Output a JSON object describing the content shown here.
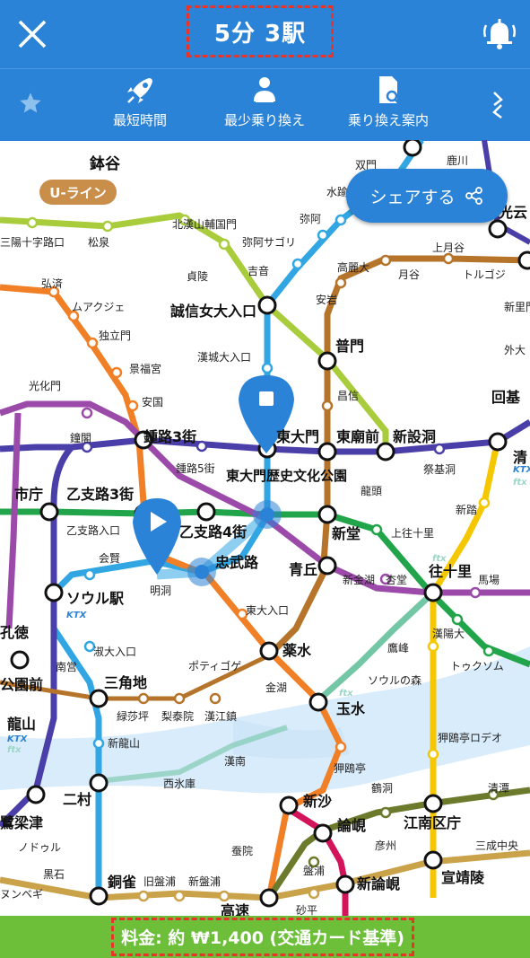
{
  "header": {
    "title": "5分 3駅"
  },
  "toolbar": {
    "items": [
      {
        "label": "最短時間",
        "icon": "rocket-icon"
      },
      {
        "label": "最少乗り換え",
        "icon": "person-icon"
      },
      {
        "label": "乗り換え案内",
        "icon": "document-search-icon"
      }
    ]
  },
  "share": {
    "label": "シェアする"
  },
  "fare": {
    "text": "料金: 約 ₩1,400 (交通カード基準)"
  },
  "map": {
    "badge": "U-ライン",
    "stations_bold": [
      "鉢谷",
      "誠信女大入口",
      "普門",
      "東廟前",
      "新設洞",
      "鍾路3街",
      "東大門",
      "回基",
      "市庁",
      "乙支路3街",
      "乙支路4街",
      "東大門歴史文化公園",
      "忠武路",
      "新堂",
      "往十里",
      "青丘",
      "ソウル駅",
      "薬水",
      "玉水",
      "三角地",
      "龍山",
      "二村",
      "新沙",
      "論峴",
      "江南区庁",
      "鷺梁津",
      "銅雀",
      "新論峴",
      "宣靖陵",
      "高速",
      "光云",
      "孔徳",
      "公園前",
      "清"
    ],
    "stations": [
      "双門",
      "鹿川",
      "水踰",
      "弥阿",
      "北漢山輔国門",
      "三陽十字路口",
      "松泉",
      "弥阿サゴリ",
      "上月谷",
      "トルゴジ",
      "貞陵",
      "吉音",
      "高麗大",
      "月谷",
      "新里門",
      "弘済",
      "ムアクジェ",
      "独立門",
      "安岩",
      "外大",
      "光化門",
      "景福宮",
      "安国",
      "漢城大入口",
      "昌信",
      "鐘閣",
      "鍾路5街",
      "祭基洞",
      "龍頭",
      "新踏",
      "乙支路入口",
      "会賢",
      "明洞",
      "上往十里",
      "新金湖",
      "杏堂",
      "馬場",
      "淑大入口",
      "南営",
      "東大入口",
      "漢陽大",
      "ポティゴゲ",
      "鷹峰",
      "トゥクソム",
      "金湖",
      "ソウルの森",
      "緑莎坪",
      "梨泰院",
      "漢江鎮",
      "新龍山",
      "漢南",
      "狎鴎亭ロデオ",
      "西氷庫",
      "狎鴎亭",
      "鶴洞",
      "清潭",
      "ノドゥル",
      "蚕院",
      "彦州",
      "三成中央",
      "黒石",
      "旧盤浦",
      "新盤浦",
      "盤浦",
      "砂平",
      "ヌンベギ"
    ]
  },
  "colors": {
    "header": "#2a83d6",
    "fare_bar": "#6dbf3a",
    "highlight": "#e8352b"
  }
}
